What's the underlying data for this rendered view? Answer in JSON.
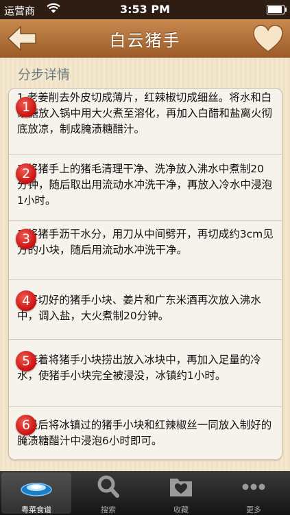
{
  "status_bar": {
    "carrier": "运营商",
    "time": "3:53 PM",
    "battery_level": 0.9
  },
  "nav": {
    "title": "白云猪手",
    "back_icon": "back-arrow-icon",
    "favorite_icon": "heart-icon"
  },
  "section_title": "分步详情",
  "steps": [
    {
      "number": "1",
      "text": "1.老姜削去外皮切成薄片，红辣椒切成细丝。将水和白砂糖放入锅中用大火煮至溶化，再加入白醋和盐离火彻底放凉，制成腌渍糖醋汁。"
    },
    {
      "number": "2",
      "text": "2.将猪手上的猪毛清理干净、洗净放入沸水中煮制20分钟，随后取出用流动水冲洗干净，再放入冷水中浸泡1小时。"
    },
    {
      "number": "3",
      "text": "3.将猪手沥干水分，用刀从中间劈开，再切成约3cm见方的小块，随后用流动水冲洗干净。"
    },
    {
      "number": "4",
      "text": "4.将切好的猪手小块、姜片和广东米酒再次放入沸水中，调入盐，大火煮制20分钟。"
    },
    {
      "number": "5",
      "text": "5.接着将猪手小块捞出放入冰块中，再加入足量的冷水，使猪手小块完全被浸没，冰镇约1小时。"
    },
    {
      "number": "6",
      "text": "6.最后将冰镇过的猪手小块和红辣椒丝一同放入制好的腌渍糖醋汁中浸泡6小时即可。"
    }
  ],
  "tabs": [
    {
      "label": "粤菜食谱",
      "icon": "dish-icon",
      "active": true
    },
    {
      "label": "搜索",
      "icon": "search-icon",
      "active": false
    },
    {
      "label": "收藏",
      "icon": "favorites-folder-icon",
      "active": false
    },
    {
      "label": "更多",
      "icon": "more-icon",
      "active": false
    }
  ],
  "colors": {
    "nav_brown": "#b06f38",
    "badge_red": "#d01818",
    "tabbar_dark": "#1e1e1e"
  }
}
